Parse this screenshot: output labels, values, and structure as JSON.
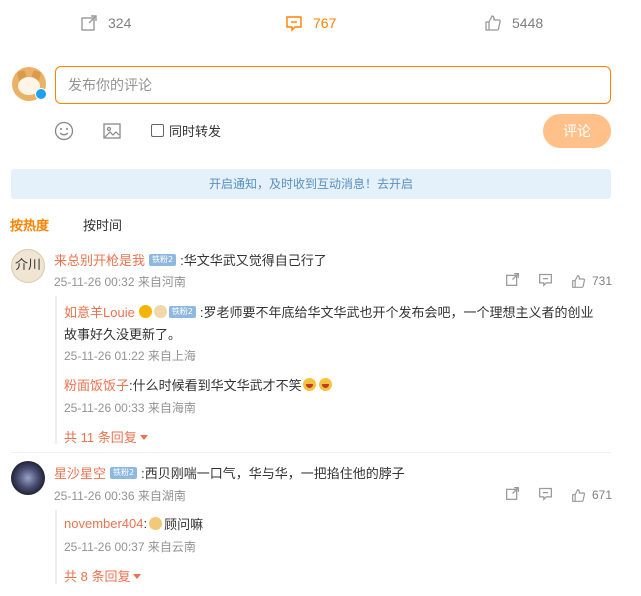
{
  "stats": {
    "share": "324",
    "comment": "767",
    "like": "5448"
  },
  "composer": {
    "placeholder": "发布你的评论",
    "repost_label": "同时转发",
    "submit_label": "评论"
  },
  "notify_text": "开启通知，及时收到互动消息！去开启",
  "sort": {
    "hot": "按热度",
    "time": "按时间"
  },
  "comments": [
    {
      "avatar_text": "介川",
      "name": "来总别开枪是我",
      "badge": "铁粉2",
      "text": ":华文华武又觉得自己行了",
      "meta": "25-11-26 00:32 来自河南",
      "likes": "731",
      "replies": [
        {
          "name": "如意羊Louie",
          "badge": "铁粉2",
          "text_line1": ":罗老师要不年底给华文华武也开个发布会吧，一个理想主义者的创业",
          "text_line2": "故事好久没更新了。",
          "meta": "25-11-26 01:22 来自上海"
        },
        {
          "name": "粉面饭饭子",
          "text": ":什么时候看到华文华武才不笑",
          "meta": "25-11-26 00:33 来自海南"
        }
      ],
      "more": "共 11 条回复"
    },
    {
      "name": "星沙星空",
      "badge": "铁粉2",
      "text": ":西贝刚喘一口气，华与华，一把掐住他的脖子",
      "meta": "25-11-26 00:36 来自湖南",
      "likes": "671",
      "replies": [
        {
          "name": "november404",
          "text": "顾问嘛",
          "meta": "25-11-26 00:37 来自云南"
        }
      ],
      "more": "共 8 条回复"
    }
  ],
  "colors": {
    "accent": "#ff8200",
    "name": "#eb7350",
    "notify_bg": "#e4f1fb",
    "submit_bg": "#ffc08a"
  }
}
